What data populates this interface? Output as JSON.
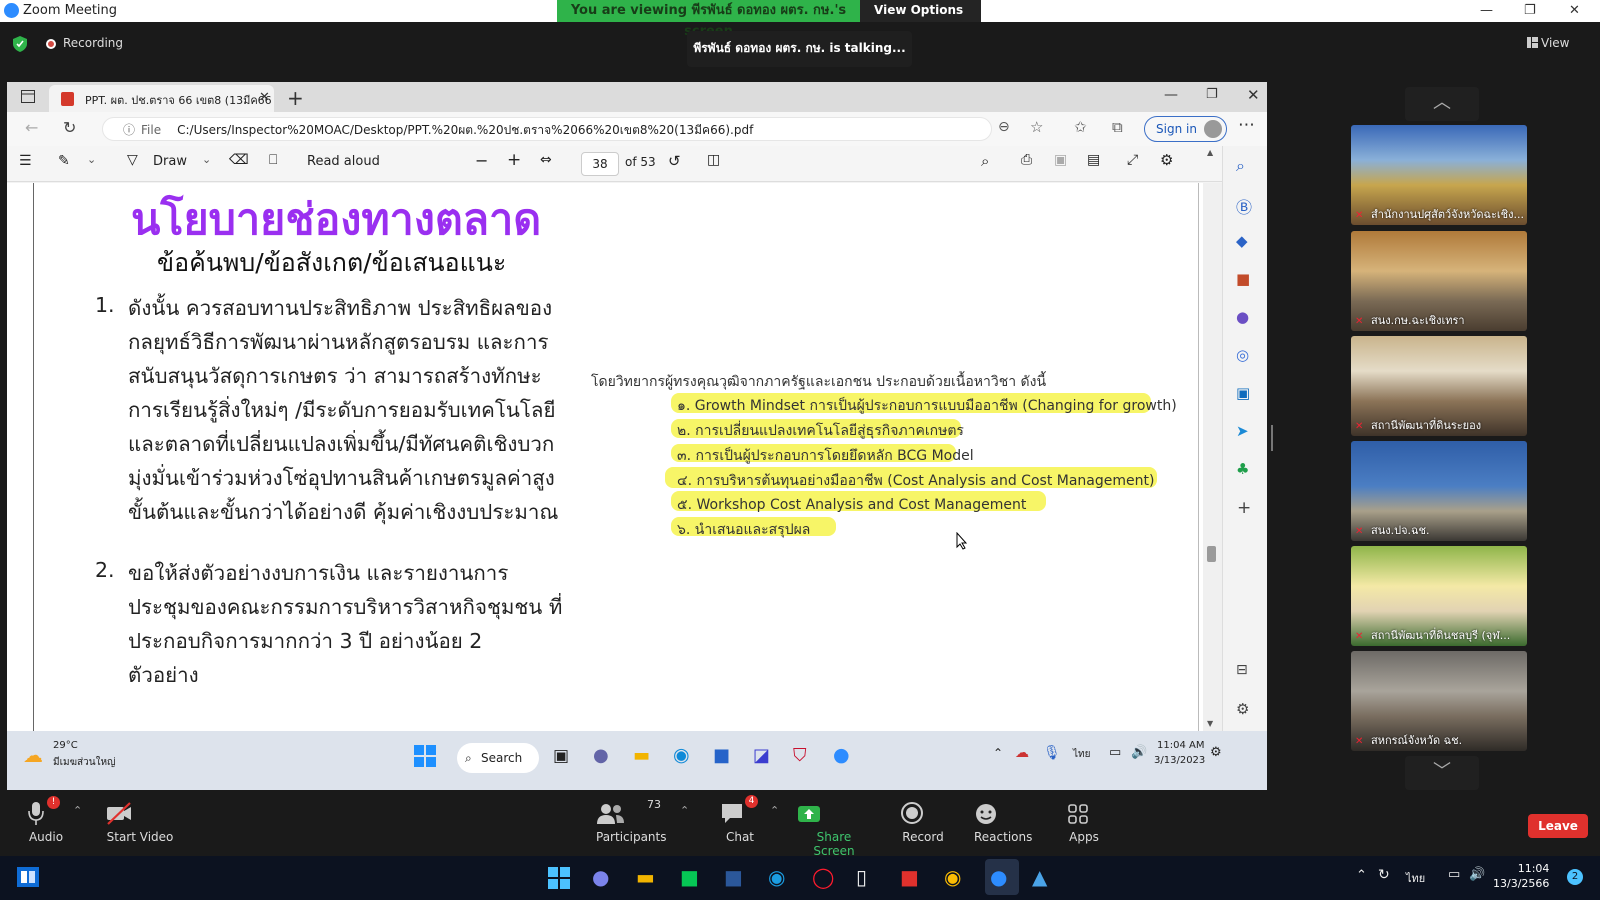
{
  "zoom": {
    "window_title": "Zoom Meeting",
    "viewing_banner": "You are viewing พีรพันธ์ ดอทอง ผตร. กษ.'s screen",
    "view_options": "View Options",
    "recording": "Recording",
    "talking": "พีรพันธ์ ดอทอง ผตร. กษ. is talking...",
    "view": "View",
    "leave": "Leave"
  },
  "browser": {
    "tab_title": "PPT. ผต. ปช.ตราจ 66 เขต8 (13มีค66",
    "url_prefix": "File",
    "url": "C:/Users/Inspector%20MOAC/Desktop/PPT.%20ผต.%20ปช.ตราจ%2066%20เขต8%20(13มีค66).pdf",
    "signin": "Sign in"
  },
  "pdf_toolbar": {
    "draw": "Draw",
    "read_aloud": "Read aloud",
    "page": "38",
    "of_pages": "of 53"
  },
  "slide": {
    "title": "นโยบายช่องทางตลาด",
    "subtitle": "ข้อค้นพบ/ข้อสังเกต/ข้อเสนอแนะ",
    "items": [
      {
        "num": "1.",
        "lines": [
          "ดังนั้น ควรสอบทานประสิทธิภาพ ประสิทธิผลของ",
          "กลยุทธ์วิธีการพัฒนาผ่านหลักสูตรอบรม และการ",
          "สนับสนุนวัสดุการเกษตร ว่า สามารถสร้างทักษะ",
          "การเรียนรู้สิ่งใหม่ๆ /มีระดับการยอมรับเทคโนโลยี",
          "และตลาดที่เปลี่ยนแปลงเพิ่มขึ้น/มีทัศนคติเชิงบวก",
          "มุ่งมั่นเข้าร่วมห่วงโซ่อุปทานสินค้าเกษตรมูลค่าสูง",
          "ขั้นต้นและขั้นกว่าได้อย่างดี คุ้มค่าเชิงงบประมาณ"
        ]
      },
      {
        "num": "2.",
        "lines": [
          "ขอให้ส่งตัวอย่างงบการเงิน และรายงานการ",
          "ประชุมของคณะกรรมการบริหารวิสาหกิจชุมชน ที่",
          "ประกอบกิจการมากกว่า 3 ปี อย่างน้อย 2",
          "ตัวอย่าง"
        ]
      }
    ],
    "agenda_intro": "โดยวิทยากรผู้ทรงคุณวุฒิจากภาครัฐและเอกชน ประกอบด้วยเนื้อหาวิชา ดังนี้",
    "agenda": [
      "๑. Growth Mindset การเป็นผู้ประกอบการแบบมืออาชีพ (Changing for growth)",
      "๒. การเปลี่ยนแปลงเทคโนโลยีสู่ธุรกิจภาคเกษตร",
      "๓. การเป็นผู้ประกอบการโดยยึดหลัก BCG Model",
      "๔. การบริหารต้นทุนอย่างมืออาชีพ (Cost Analysis and Cost Management)",
      "๕. Workshop Cost Analysis and Cost Management",
      "๖. นำเสนอและสรุปผล"
    ]
  },
  "inner_taskbar": {
    "weather_temp": "29°C",
    "weather_desc": "มีเมฆส่วนใหญ่",
    "search": "Search",
    "time": "11:04 AM",
    "date": "3/13/2023",
    "lang": "ไทย"
  },
  "participants_panel": [
    "สำนักงานปศุสัตว์จังหวัดฉะเชิง...",
    "สนง.กษ.ฉะเชิงเทรา",
    "สถานีพัฒนาที่ดินระยอง",
    "สนง.ปจ.ฉช.",
    "สถานีพัฒนาที่ดินชลบุรี (จุฬ...",
    "สหกรณ์จังหวัด ฉช."
  ],
  "zoom_toolbar": {
    "audio": "Audio",
    "video": "Start Video",
    "participants": "Participants",
    "participants_count": "73",
    "chat": "Chat",
    "chat_badge": "4",
    "share": "Share Screen",
    "record": "Record",
    "reactions": "Reactions",
    "apps": "Apps",
    "audio_badge": "!"
  },
  "win_taskbar": {
    "time": "11:04",
    "date": "13/3/2566",
    "lang": "ไทย",
    "notif": "2"
  }
}
